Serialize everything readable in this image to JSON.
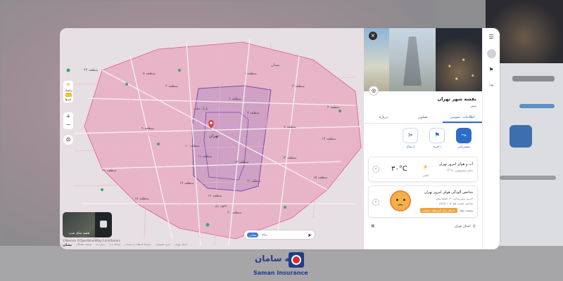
{
  "brand": {
    "name_fa": "بیمه سامان",
    "name_en": "Saman Insurance"
  },
  "map": {
    "labels": [
      "منطقه ۲۲",
      "منطقه ۵",
      "منطقه ۲",
      "منطقه ۱",
      "منطقه ۳",
      "منطقه ۴",
      "منطقه ۶",
      "منطقه ۷",
      "منطقه ۸",
      "منطقه ۱۳",
      "منطقه ۹",
      "منطقه ۱۰",
      "منطقه ۱۱",
      "منطقه ۱۲",
      "منطقه ۱۴",
      "منطقه ۱۵",
      "منطقه ۱۶",
      "منطقه ۱۷",
      "منطقه ۱۸",
      "منطقه ۱۹",
      "منطقه ۲۰",
      "منطقه ۲۱",
      "تهران",
      "شهر ری",
      "پارک ملت",
      "بستان"
    ],
    "tools": {
      "traffic_label": "ترافیک",
      "layers_label": "لایه‌ها"
    },
    "zoom_in": "+",
    "zoom_out": "−",
    "thumbnail_label": "نقشه نمای شب",
    "attribution": "©Neshan ©OpenStreetMap Contributors",
    "footer_logo": "نشان",
    "footer_links": [
      "توسعه دهندگان",
      "درباره ما",
      "ارتباط با ما",
      "شرایط استفاده از خدمات",
      "حریم خصوصی",
      "استان تهران"
    ],
    "search": {
      "pill": "نشانی",
      "text": "برای"
    },
    "colors": {
      "district": "#e8a7bf",
      "highlight": "#9f7bbf",
      "pin": "#e23b3b"
    }
  },
  "panel": {
    "title": "نقشه شهر تهران",
    "subtitle": "شهر",
    "close_icon": "×",
    "camera_icon": "◎",
    "tabs": [
      {
        "label": "اطلاعات عمومی",
        "active": true
      },
      {
        "label": "تصاویر",
        "active": false
      },
      {
        "label": "درباره",
        "active": false
      }
    ],
    "actions": [
      {
        "label": "مسیریابی",
        "icon": "route-icon",
        "glyph": "⤳"
      },
      {
        "label": "ذخیره",
        "icon": "bookmark-icon",
        "glyph": "⚑"
      },
      {
        "label": "ارسال",
        "icon": "share-icon",
        "glyph": "⋖"
      }
    ],
    "weather": {
      "title": "آب و هوای امروز تهران",
      "detail": "دمای محسوس: ۲۲°C",
      "condition": "آفتابی",
      "temp": "۳۰°C"
    },
    "air": {
      "title": "شاخص آلودگی هوای امروز تهران",
      "updated": "اخرین بروزرسانی: ۱۴ دقیقه پیش",
      "index": "شاخص کیفیت هوا: ۱۰۵ (AQI)",
      "status_label": "وضعیت هوا:",
      "status": "ناسالم برای گروه‌های حساس"
    },
    "location": "استان تهران"
  },
  "rail": {
    "menu_icon": "☰",
    "bookmark_icon": "⚑",
    "route_icon": "⤳"
  }
}
